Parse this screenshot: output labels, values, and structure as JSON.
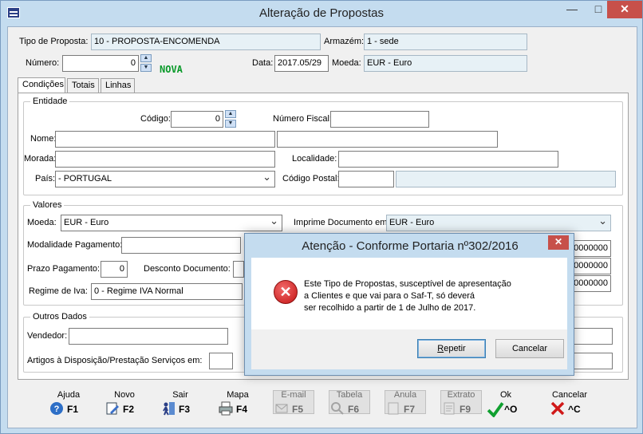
{
  "window": {
    "title": "Alteração de Propostas",
    "minimize": "—",
    "maximize": "□",
    "close": "✕"
  },
  "header": {
    "tipo_label": "Tipo de Proposta:",
    "tipo_value": "10 - PROPOSTA-ENCOMENDA",
    "armazem_label": "Armazém:",
    "armazem_value": "1 - sede",
    "numero_label": "Número:",
    "numero_value": "0",
    "status": "NOVA",
    "data_label": "Data:",
    "data_value": "2017.05/29",
    "moeda_label": "Moeda:",
    "moeda_value": "EUR - Euro"
  },
  "tabs": [
    "Condições",
    "Totais",
    "Linhas"
  ],
  "entidade": {
    "title": "Entidade",
    "codigo_label": "Código:",
    "codigo_value": "0",
    "nif_label": "Número Fiscal:",
    "nome_label": "Nome:",
    "morada_label": "Morada:",
    "localidade_label": "Localidade:",
    "pais_label": "País:",
    "pais_value": " - PORTUGAL",
    "postal_label": "Código Postal:"
  },
  "valores": {
    "title": "Valores",
    "moeda_label": "Moeda:",
    "moeda_value": "EUR - Euro",
    "imprime_label": "Imprime Documento em:",
    "imprime_value": "EUR - Euro",
    "modalidade_label": "Modalidade Pagamento:",
    "prazo_label": "Prazo Pagamento:",
    "prazo_value": "0",
    "desconto_label": "Desconto Documento:",
    "regime_label": "Regime de Iva:",
    "regime_value": "0 - Regime IVA Normal",
    "right_values": [
      "0000000",
      "0000000",
      "0000000"
    ]
  },
  "outros": {
    "title": "Outros Dados",
    "vendedor_label": "Vendedor:",
    "artigos_label": "Artigos à Disposição/Prestação Serviços em:"
  },
  "toolbar": [
    {
      "label": "Ajuda",
      "key": "F1",
      "icon": "help-icon",
      "enabled": true
    },
    {
      "label": "Novo",
      "key": "F2",
      "icon": "new-document-icon",
      "enabled": true
    },
    {
      "label": "Sair",
      "key": "F3",
      "icon": "exit-person-icon",
      "enabled": true
    },
    {
      "label": "Mapa",
      "key": "F4",
      "icon": "printer-icon",
      "enabled": true
    },
    {
      "label": "E-mail",
      "key": "F5",
      "icon": "email-icon",
      "enabled": false
    },
    {
      "label": "Tabela",
      "key": "F6",
      "icon": "search-table-icon",
      "enabled": false
    },
    {
      "label": "Anula",
      "key": "F7",
      "icon": "cancel-doc-icon",
      "enabled": false
    },
    {
      "label": "Extrato",
      "key": "F9",
      "icon": "statement-icon",
      "enabled": false
    },
    {
      "label": "Ok",
      "key": "^O",
      "icon": "check-icon",
      "enabled": true
    },
    {
      "label": "Cancelar",
      "key": "^C",
      "icon": "x-icon",
      "enabled": true
    }
  ],
  "dialog": {
    "title": "Atenção - Conforme Portaria nº302/2016",
    "close": "✕",
    "icon_glyph": "✕",
    "message_lines": [
      "Este Tipo de Propostas, susceptível de apresentação",
      "a Clientes e que vai para o Saf-T, só deverá",
      "ser recolhido a partir de 1 de Julho de 2017."
    ],
    "repeat_underlined": "R",
    "repeat_rest": "epetir",
    "cancel_label": "Cancelar"
  },
  "colors": {
    "frame": "#c4dcef",
    "close": "#c7504a",
    "nova": "#0a9a2a",
    "error": "#c41414"
  }
}
